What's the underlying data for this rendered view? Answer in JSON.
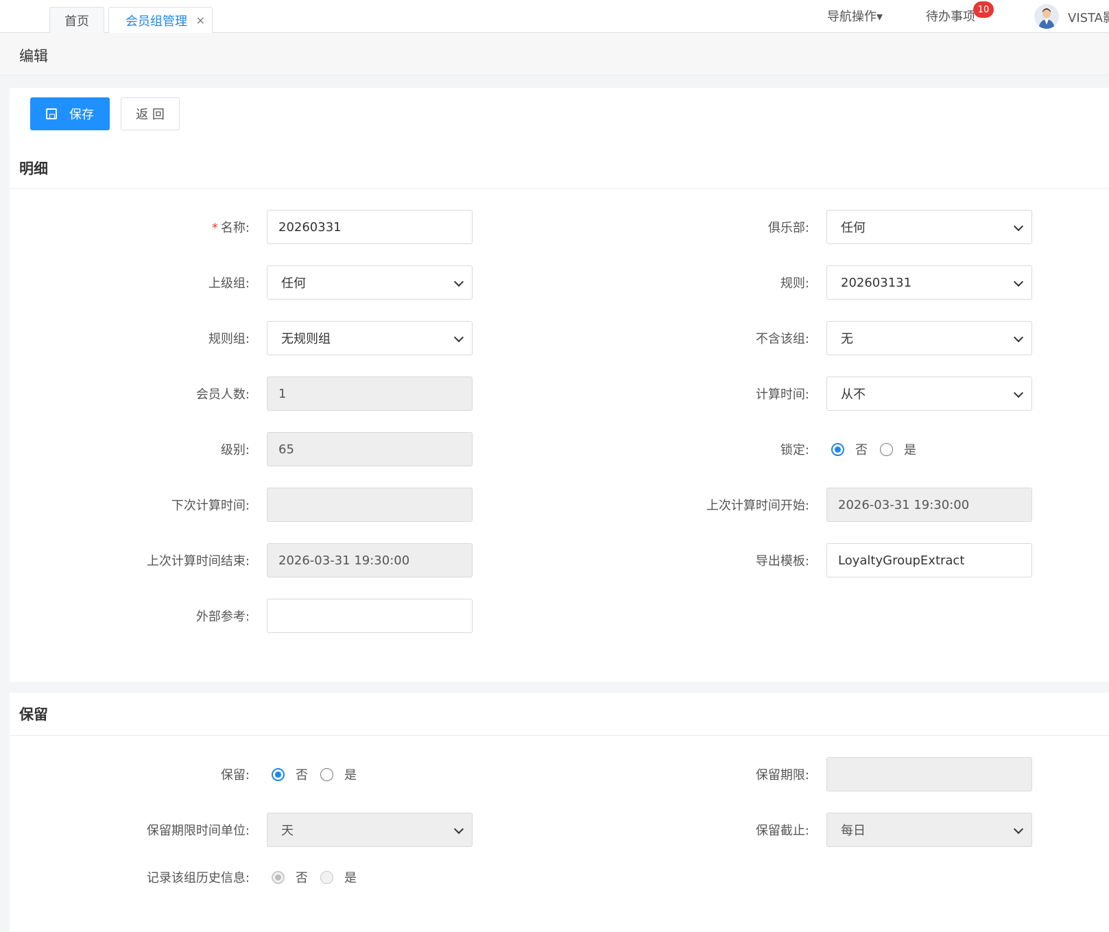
{
  "tabs": [
    {
      "label": "首页"
    },
    {
      "label": "会员组管理",
      "close": "×"
    }
  ],
  "header": {
    "nav_ops": "导航操作▾",
    "todo": "待办事项",
    "todo_count": "10",
    "username": "VISTA影"
  },
  "page_title": "编辑",
  "toolbar": {
    "save_label": "保存",
    "back_label": "返 回"
  },
  "detail": {
    "section_title": "明细",
    "name_label": "名称:",
    "name_value": "20260331",
    "club_label": "俱乐部:",
    "club_value": "任何",
    "parent_label": "上级组:",
    "parent_value": "任何",
    "rule_label": "规则:",
    "rule_value": "202603131",
    "rulegroup_label": "规则组:",
    "rulegroup_value": "无规则组",
    "exclude_label": "不含该组:",
    "exclude_value": "无",
    "member_count_label": "会员人数:",
    "member_count_value": "1",
    "calc_time_label": "计算时间:",
    "calc_time_value": "从不",
    "level_label": "级别:",
    "level_value": "65",
    "lock_label": "锁定:",
    "lock_no": "否",
    "lock_yes": "是",
    "next_calc_label": "下次计算时间:",
    "next_calc_value": "",
    "last_start_label": "上次计算时间开始:",
    "last_start_value": "2026-03-31 19:30:00",
    "last_end_label": "上次计算时间结束:",
    "last_end_value": "2026-03-31 19:30:00",
    "export_label": "导出模板:",
    "export_value": "LoyaltyGroupExtract",
    "external_label": "外部参考:",
    "external_value": ""
  },
  "retention": {
    "section_title": "保留",
    "retain_label": "保留:",
    "retain_no": "否",
    "retain_yes": "是",
    "period_label": "保留期限:",
    "period_value": "",
    "unit_label": "保留期限时间单位:",
    "unit_value": "天",
    "cutoff_label": "保留截止:",
    "cutoff_value": "每日",
    "history_label": "记录该组历史信息:",
    "history_no": "否",
    "history_yes": "是"
  },
  "colors": {
    "primary": "#1e90ff",
    "danger": "#e53935"
  }
}
